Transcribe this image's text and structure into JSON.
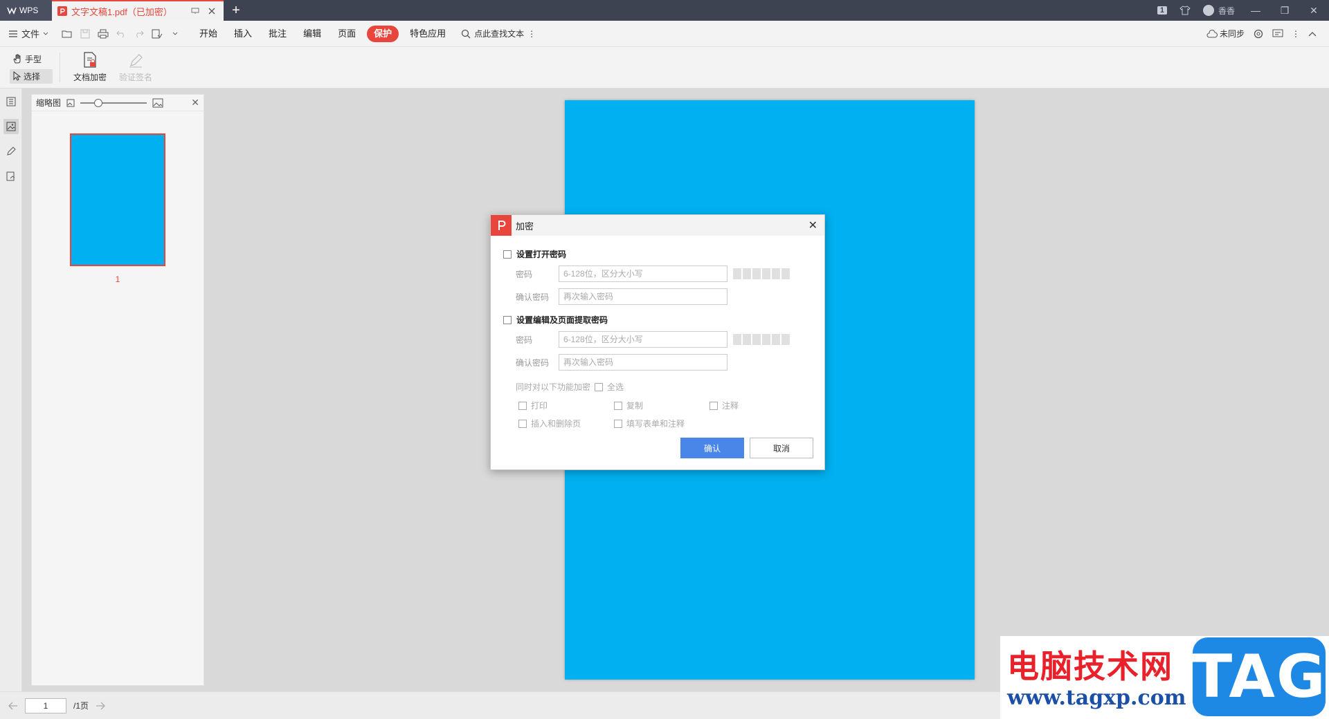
{
  "titlebar": {
    "app_tab": "WPS",
    "doc_tab": "文字文稿1.pdf（已加密）",
    "new_tab": "+",
    "page_badge": "1",
    "user": "香香"
  },
  "menubar": {
    "file": "文件",
    "items": [
      "开始",
      "插入",
      "批注",
      "编辑",
      "页面",
      "保护",
      "特色应用"
    ],
    "active_item": "保护",
    "search": "点此查找文本",
    "sync": "未同步"
  },
  "ribbon": {
    "hand": "手型",
    "select": "选择",
    "encrypt": "文档加密",
    "verify": "验证签名"
  },
  "thumbnail": {
    "title": "缩略图",
    "page_label": "1"
  },
  "dialog": {
    "title": "加密",
    "open_section": "设置打开密码",
    "edit_section": "设置编辑及页面提取密码",
    "password_label": "密码",
    "confirm_label": "确认密码",
    "password_placeholder": "6-128位，区分大小写",
    "confirm_placeholder": "再次输入密码",
    "also_encrypt": "同时对以下功能加密",
    "select_all": "全选",
    "options": [
      "打印",
      "复制",
      "注释",
      "插入和删除页",
      "填写表单和注释"
    ],
    "ok": "确认",
    "cancel": "取消"
  },
  "statusbar": {
    "current_page": "1",
    "total_pages": "/1页"
  },
  "watermark": {
    "cn": "电脑技术网",
    "url": "www.tagxp.com",
    "tag": "TAG"
  },
  "colors": {
    "accent": "#e8453c",
    "page_fill": "#00b0f0",
    "primary_button": "#4a86e8"
  }
}
